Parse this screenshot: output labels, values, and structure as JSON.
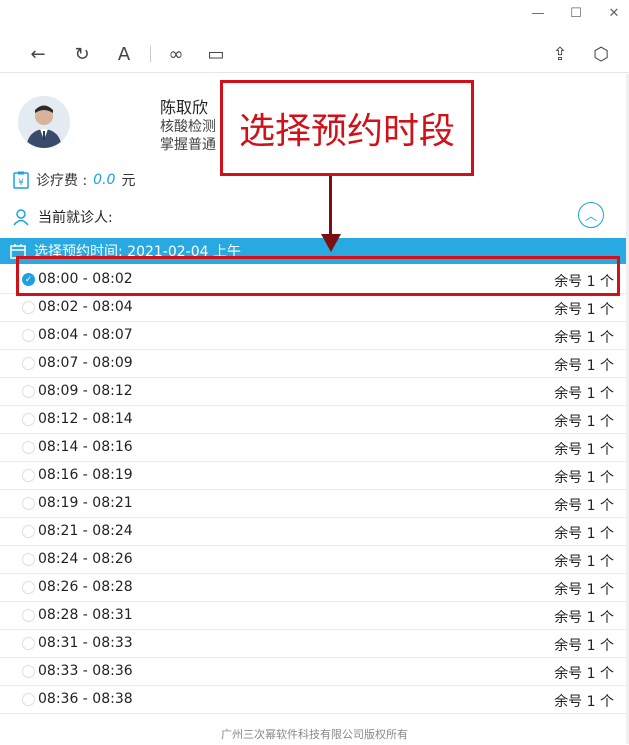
{
  "window": {
    "minimize": "—",
    "maximize": "☐",
    "close": "✕"
  },
  "toolbar": {
    "back": "←",
    "refresh": "↻",
    "font": "A",
    "link": "∞",
    "window": "▭",
    "share": "⇪",
    "box": "⬡"
  },
  "doctor": {
    "name": "陈取欣",
    "line1": "核酸检测",
    "line2": "掌握普通"
  },
  "fee": {
    "label": "诊疗费 :",
    "value": "0.0",
    "unit": "元"
  },
  "patient": {
    "label": "当前就诊人:"
  },
  "time_select": {
    "label": "选择预约时间: 2021-02-04 上午"
  },
  "slots": [
    {
      "time": "08:00 - 08:02",
      "remain": "余号 1 个",
      "checked": true
    },
    {
      "time": "08:02 - 08:04",
      "remain": "余号 1 个",
      "checked": false
    },
    {
      "time": "08:04 - 08:07",
      "remain": "余号 1 个",
      "checked": false
    },
    {
      "time": "08:07 - 08:09",
      "remain": "余号 1 个",
      "checked": false
    },
    {
      "time": "08:09 - 08:12",
      "remain": "余号 1 个",
      "checked": false
    },
    {
      "time": "08:12 - 08:14",
      "remain": "余号 1 个",
      "checked": false
    },
    {
      "time": "08:14 - 08:16",
      "remain": "余号 1 个",
      "checked": false
    },
    {
      "time": "08:16 - 08:19",
      "remain": "余号 1 个",
      "checked": false
    },
    {
      "time": "08:19 - 08:21",
      "remain": "余号 1 个",
      "checked": false
    },
    {
      "time": "08:21 - 08:24",
      "remain": "余号 1 个",
      "checked": false
    },
    {
      "time": "08:24 - 08:26",
      "remain": "余号 1 个",
      "checked": false
    },
    {
      "time": "08:26 - 08:28",
      "remain": "余号 1 个",
      "checked": false
    },
    {
      "time": "08:28 - 08:31",
      "remain": "余号 1 个",
      "checked": false
    },
    {
      "time": "08:31 - 08:33",
      "remain": "余号 1 个",
      "checked": false
    },
    {
      "time": "08:33 - 08:36",
      "remain": "余号 1 个",
      "checked": false
    },
    {
      "time": "08:36 - 08:38",
      "remain": "余号 1 个",
      "checked": false
    }
  ],
  "footer": "广州三次幂软件科技有限公司版权所有",
  "annotation": {
    "text": "选择预约时段"
  },
  "colors": {
    "accent": "#29a9e1",
    "annotation": "#d0111a"
  }
}
